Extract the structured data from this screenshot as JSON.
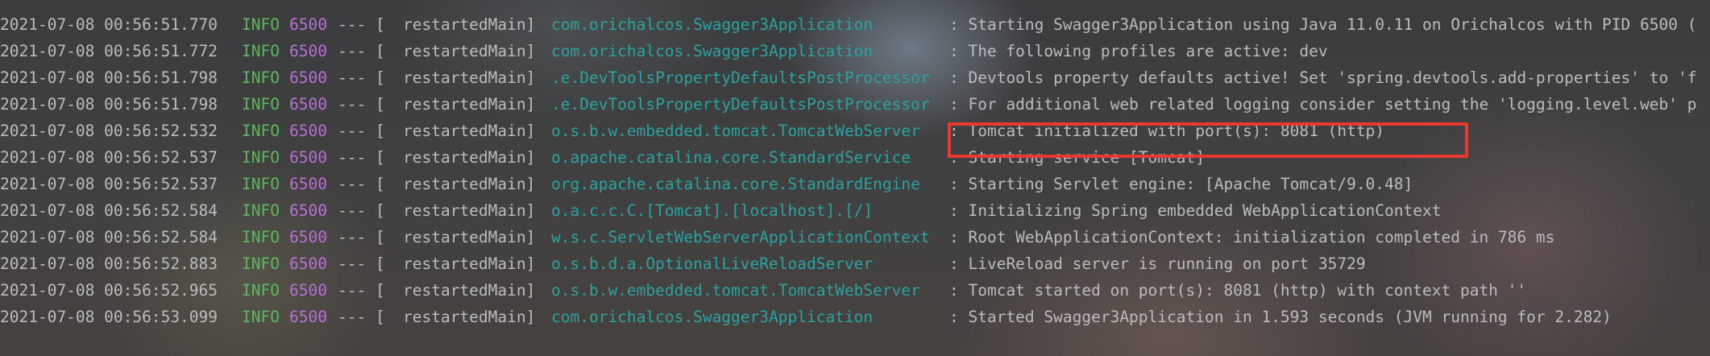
{
  "console": {
    "lines": [
      {
        "timestamp": "2021-07-08 00:56:51.770",
        "level": "INFO",
        "pid": "6500",
        "separator": "--- [",
        "thread": "restartedMain]",
        "logger": "com.orichalcos.Swagger3Application",
        "message": ": Starting Swagger3Application using Java 11.0.11 on Orichalcos with PID 6500 ("
      },
      {
        "timestamp": "2021-07-08 00:56:51.772",
        "level": "INFO",
        "pid": "6500",
        "separator": "--- [",
        "thread": "restartedMain]",
        "logger": "com.orichalcos.Swagger3Application",
        "message": ": The following profiles are active: dev"
      },
      {
        "timestamp": "2021-07-08 00:56:51.798",
        "level": "INFO",
        "pid": "6500",
        "separator": "--- [",
        "thread": "restartedMain]",
        "logger": ".e.DevToolsPropertyDefaultsPostProcessor",
        "message": ": Devtools property defaults active! Set 'spring.devtools.add-properties' to 'f"
      },
      {
        "timestamp": "2021-07-08 00:56:51.798",
        "level": "INFO",
        "pid": "6500",
        "separator": "--- [",
        "thread": "restartedMain]",
        "logger": ".e.DevToolsPropertyDefaultsPostProcessor",
        "message": ": For additional web related logging consider setting the 'logging.level.web' p"
      },
      {
        "timestamp": "2021-07-08 00:56:52.532",
        "level": "INFO",
        "pid": "6500",
        "separator": "--- [",
        "thread": "restartedMain]",
        "logger": "o.s.b.w.embedded.tomcat.TomcatWebServer",
        "message": ": Tomcat initialized with port(s): 8081 (http)"
      },
      {
        "timestamp": "2021-07-08 00:56:52.537",
        "level": "INFO",
        "pid": "6500",
        "separator": "--- [",
        "thread": "restartedMain]",
        "logger": "o.apache.catalina.core.StandardService",
        "message": ": Starting service [Tomcat]"
      },
      {
        "timestamp": "2021-07-08 00:56:52.537",
        "level": "INFO",
        "pid": "6500",
        "separator": "--- [",
        "thread": "restartedMain]",
        "logger": "org.apache.catalina.core.StandardEngine",
        "message": ": Starting Servlet engine: [Apache Tomcat/9.0.48]"
      },
      {
        "timestamp": "2021-07-08 00:56:52.584",
        "level": "INFO",
        "pid": "6500",
        "separator": "--- [",
        "thread": "restartedMain]",
        "logger": "o.a.c.c.C.[Tomcat].[localhost].[/]",
        "message": ": Initializing Spring embedded WebApplicationContext"
      },
      {
        "timestamp": "2021-07-08 00:56:52.584",
        "level": "INFO",
        "pid": "6500",
        "separator": "--- [",
        "thread": "restartedMain]",
        "logger": "w.s.c.ServletWebServerApplicationContext",
        "message": ": Root WebApplicationContext: initialization completed in 786 ms"
      },
      {
        "timestamp": "2021-07-08 00:56:52.883",
        "level": "INFO",
        "pid": "6500",
        "separator": "--- [",
        "thread": "restartedMain]",
        "logger": "o.s.b.d.a.OptionalLiveReloadServer",
        "message": ": LiveReload server is running on port 35729"
      },
      {
        "timestamp": "2021-07-08 00:56:52.965",
        "level": "INFO",
        "pid": "6500",
        "separator": "--- [",
        "thread": "restartedMain]",
        "logger": "o.s.b.w.embedded.tomcat.TomcatWebServer",
        "message": ": Tomcat started on port(s): 8081 (http) with context path ''"
      },
      {
        "timestamp": "2021-07-08 00:56:53.099",
        "level": "INFO",
        "pid": "6500",
        "separator": "--- [",
        "thread": "restartedMain]",
        "logger": "com.orichalcos.Swagger3Application",
        "message": ": Started Swagger3Application in 1.593 seconds (JVM running for 2.282)"
      }
    ]
  },
  "colors": {
    "timestamp": "#bbbcbe",
    "level_info": "#5cb85c",
    "pid": "#b86fd6",
    "logger": "#2aa3a0",
    "highlight_box": "#e8382f"
  }
}
